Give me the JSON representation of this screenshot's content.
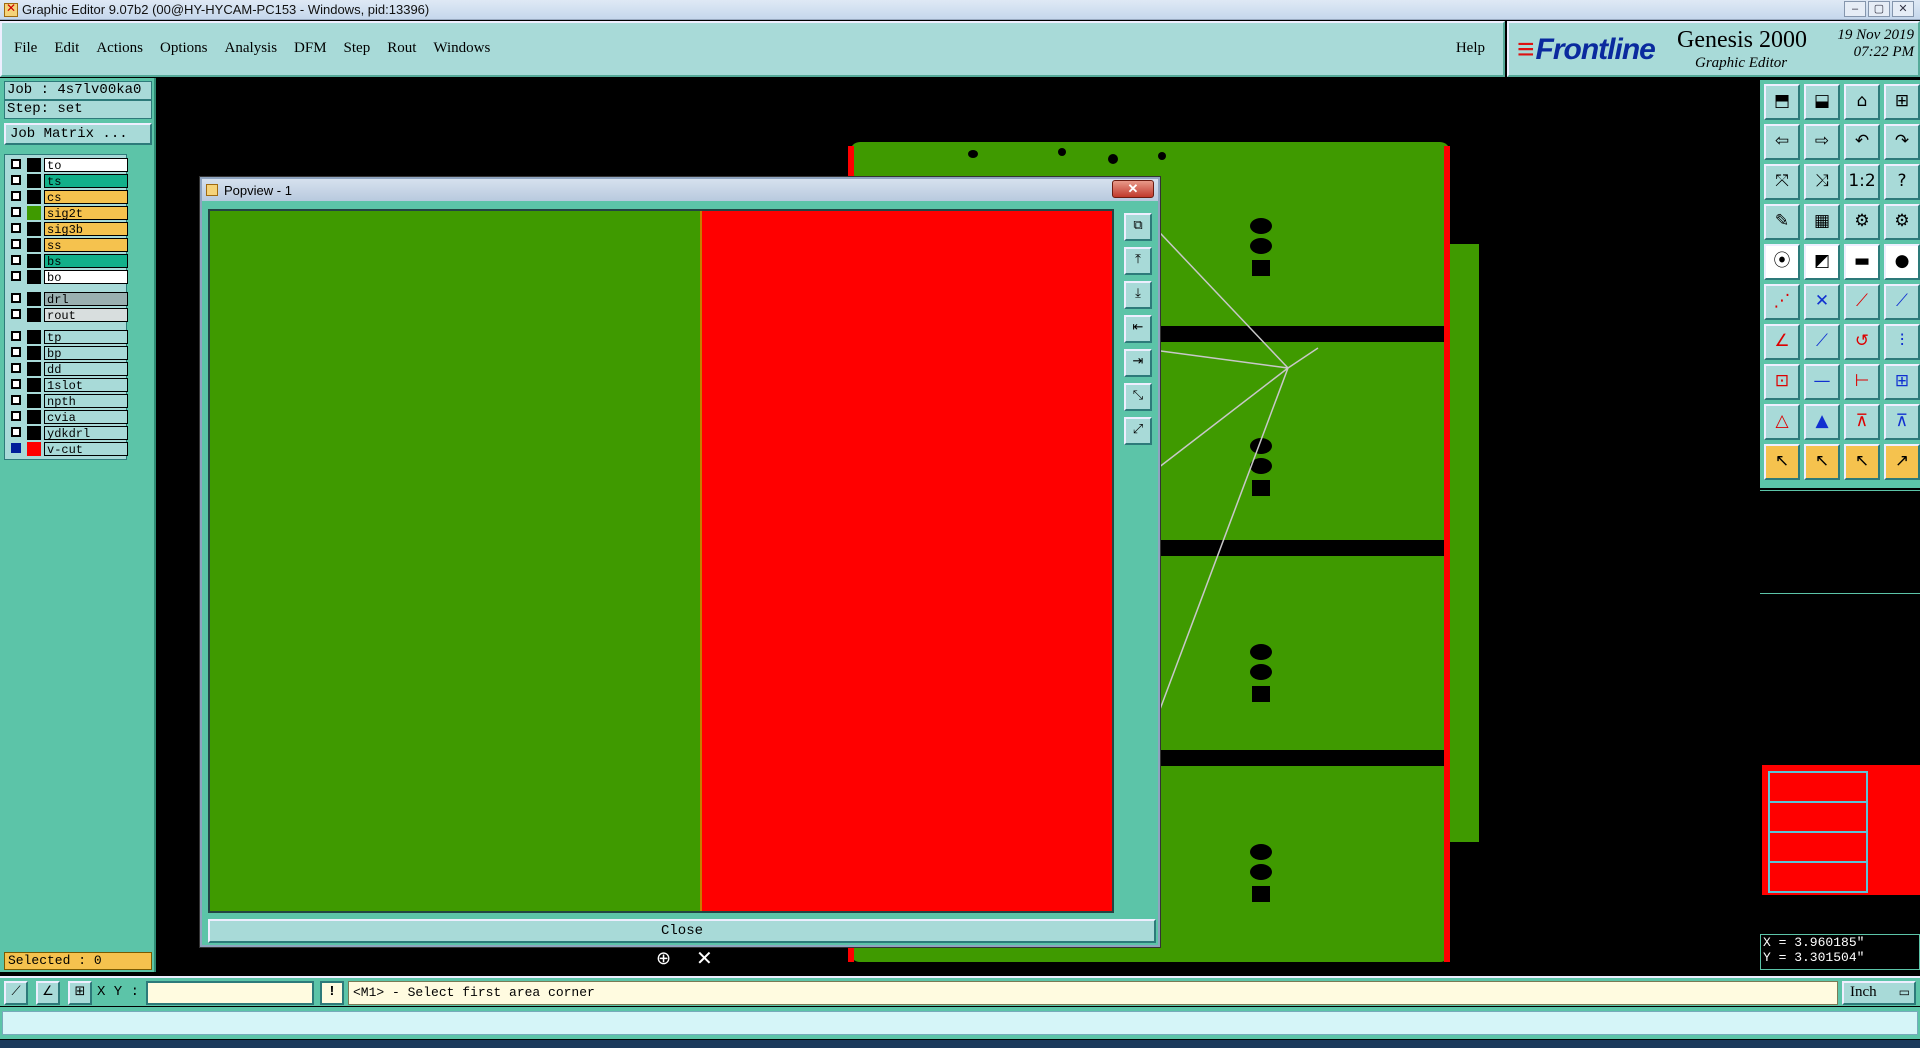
{
  "window": {
    "title": "Graphic Editor 9.07b2 (00@HY-HYCAM-PC153 - Windows, pid:13396)",
    "controls": [
      "–",
      "▢",
      "✕"
    ]
  },
  "menu": {
    "items": [
      "File",
      "Edit",
      "Actions",
      "Options",
      "Analysis",
      "DFM",
      "Step",
      "Rout",
      "Windows"
    ],
    "help": "Help"
  },
  "brand": {
    "logo": "Frontline",
    "product": "Genesis 2000",
    "subtitle": "Graphic Editor",
    "date": "19 Nov 2019",
    "time": "07:22 PM"
  },
  "job": {
    "job_line": "Job : 4s7lv00ka0",
    "step_line": "Step: set",
    "matrix_button": "Job Matrix ..."
  },
  "layers": [
    {
      "name": "to",
      "color": "#ffffff",
      "swatch": "#000000",
      "selected": false
    },
    {
      "name": "ts",
      "color": "#12b08a",
      "swatch": "#000000",
      "selected": false
    },
    {
      "name": "cs",
      "color": "#f5c24e",
      "swatch": "#000000",
      "selected": false
    },
    {
      "name": "sig2t",
      "color": "#f5c24e",
      "swatch": "#3f9a00",
      "selected": false
    },
    {
      "name": "sig3b",
      "color": "#f5c24e",
      "swatch": "#000000",
      "selected": false
    },
    {
      "name": "ss",
      "color": "#f5c24e",
      "swatch": "#000000",
      "selected": false
    },
    {
      "name": "bs",
      "color": "#12b08a",
      "swatch": "#000000",
      "selected": false
    },
    {
      "name": "bo",
      "color": "#ffffff",
      "swatch": "#000000",
      "selected": false
    },
    {
      "name": "drl",
      "color": "#9ab0b0",
      "swatch": "#000000",
      "selected": false,
      "gap_before": true
    },
    {
      "name": "rout",
      "color": "#d8dede",
      "swatch": "#000000",
      "selected": false
    },
    {
      "name": "tp",
      "color": "#a8dad8",
      "swatch": "#000000",
      "selected": false,
      "gap_before": true
    },
    {
      "name": "bp",
      "color": "#a8dad8",
      "swatch": "#000000",
      "selected": false
    },
    {
      "name": "dd",
      "color": "#a8dad8",
      "swatch": "#000000",
      "selected": false
    },
    {
      "name": "1slot",
      "color": "#a8dad8",
      "swatch": "#000000",
      "selected": false
    },
    {
      "name": "npth",
      "color": "#a8dad8",
      "swatch": "#000000",
      "selected": false
    },
    {
      "name": "cvia",
      "color": "#a8dad8",
      "swatch": "#000000",
      "selected": false
    },
    {
      "name": "ydkdrl",
      "color": "#a8dad8",
      "swatch": "#000000",
      "selected": false
    },
    {
      "name": "v-cut",
      "color": "#a8dad8",
      "swatch": "#ff0000",
      "selected": true
    }
  ],
  "selected_count": "Selected : 0",
  "popview": {
    "title": "Popview - 1",
    "close_x": "✕",
    "close_button": "Close",
    "tools": [
      "⧉",
      "⤒",
      "⤓",
      "⇤",
      "⇥",
      "⤡",
      "⤢"
    ]
  },
  "right_tools": [
    [
      "⬒",
      "⬓",
      "⌂",
      "⊞"
    ],
    [
      "⇦",
      "⇨",
      "↶",
      "↷"
    ],
    [
      "⤧",
      "⤨",
      "1:2",
      "?"
    ],
    [
      "✎",
      "▦",
      "⚙",
      "⚙"
    ],
    [
      "⦿",
      "◩",
      "▬",
      "●"
    ],
    [
      "⋰",
      "✕",
      "⟋",
      "⟋"
    ],
    [
      "∠",
      "⟋",
      "↺",
      "⫶"
    ],
    [
      "⊡",
      "—",
      "⊢",
      "⊞"
    ],
    [
      "△",
      "▲",
      "⊼",
      "⊼"
    ],
    [
      "↖",
      "↖",
      "↖",
      "↗"
    ]
  ],
  "coords": {
    "x": "X = 3.960185\"",
    "y": "Y = 3.301504\""
  },
  "statusbar": {
    "icons": [
      "⟋",
      "∠",
      "⊞"
    ],
    "xy_label": "X Y :",
    "xy_value": "",
    "msg_icon": "!",
    "message": "<M1> - Select first area corner",
    "unit": "Inch"
  },
  "colors": {
    "panel": "#5cc4a8",
    "button": "#a8dad8",
    "copper": "#3f9a00",
    "vcut": "#ff0000"
  }
}
